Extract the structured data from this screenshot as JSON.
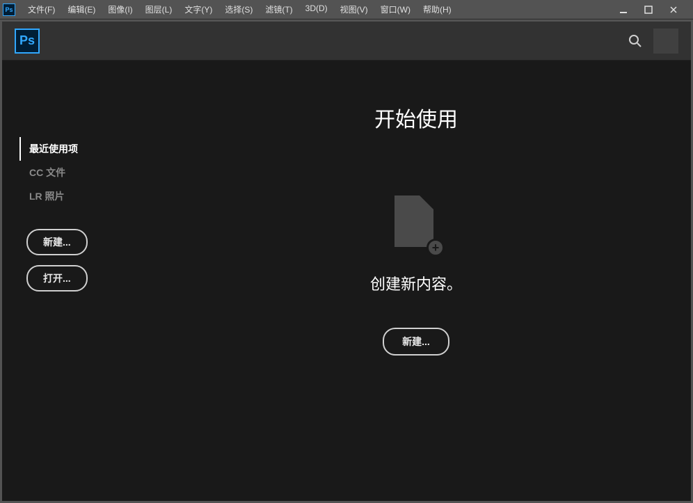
{
  "menubar": {
    "items": [
      "文件(F)",
      "编辑(E)",
      "图像(I)",
      "图层(L)",
      "文字(Y)",
      "选择(S)",
      "滤镜(T)",
      "3D(D)",
      "视图(V)",
      "窗口(W)",
      "帮助(H)"
    ]
  },
  "app": {
    "logo_text": "Ps"
  },
  "sidebar": {
    "items": [
      {
        "label": "最近使用项",
        "active": true
      },
      {
        "label": "CC 文件",
        "active": false
      },
      {
        "label": "LR 照片",
        "active": false
      }
    ],
    "new_button": "新建...",
    "open_button": "打开..."
  },
  "main": {
    "title": "开始使用",
    "create_text": "创建新内容。",
    "new_button": "新建..."
  }
}
